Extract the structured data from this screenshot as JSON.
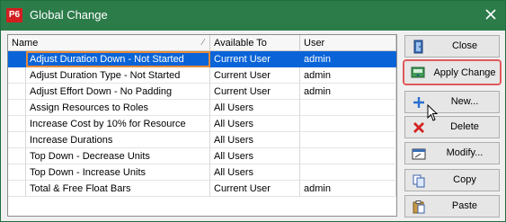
{
  "window": {
    "app_icon_label": "P6",
    "title": "Global Change"
  },
  "grid": {
    "columns": [
      {
        "key": "name",
        "label": "Name"
      },
      {
        "key": "available_to",
        "label": "Available To"
      },
      {
        "key": "user",
        "label": "User"
      }
    ],
    "rows": [
      {
        "name": "Adjust Duration Down - Not Started",
        "available_to": "Current User",
        "user": "admin",
        "selected": true
      },
      {
        "name": "Adjust Duration Type - Not Started",
        "available_to": "Current User",
        "user": "admin",
        "selected": false
      },
      {
        "name": "Adjust Effort Down - No Padding",
        "available_to": "Current User",
        "user": "admin",
        "selected": false
      },
      {
        "name": "Assign Resources to Roles",
        "available_to": "All Users",
        "user": "",
        "selected": false
      },
      {
        "name": "Increase Cost by 10% for Resource",
        "available_to": "All Users",
        "user": "",
        "selected": false
      },
      {
        "name": "Increase Durations",
        "available_to": "All Users",
        "user": "",
        "selected": false
      },
      {
        "name": "Top Down - Decrease Units",
        "available_to": "All Users",
        "user": "",
        "selected": false
      },
      {
        "name": "Top Down - Increase Units",
        "available_to": "All Users",
        "user": "",
        "selected": false
      },
      {
        "name": "Total & Free Float Bars",
        "available_to": "Current User",
        "user": "admin",
        "selected": false
      }
    ]
  },
  "buttons": {
    "close": "Close",
    "apply_change": "Apply Change",
    "new": "New...",
    "delete": "Delete",
    "modify": "Modify...",
    "copy": "Copy",
    "paste": "Paste"
  },
  "colors": {
    "titlebar": "#2c7c4a",
    "selection": "#0a64d8",
    "focus_outline": "#e58a3c",
    "highlight_border": "#e05a5a"
  }
}
